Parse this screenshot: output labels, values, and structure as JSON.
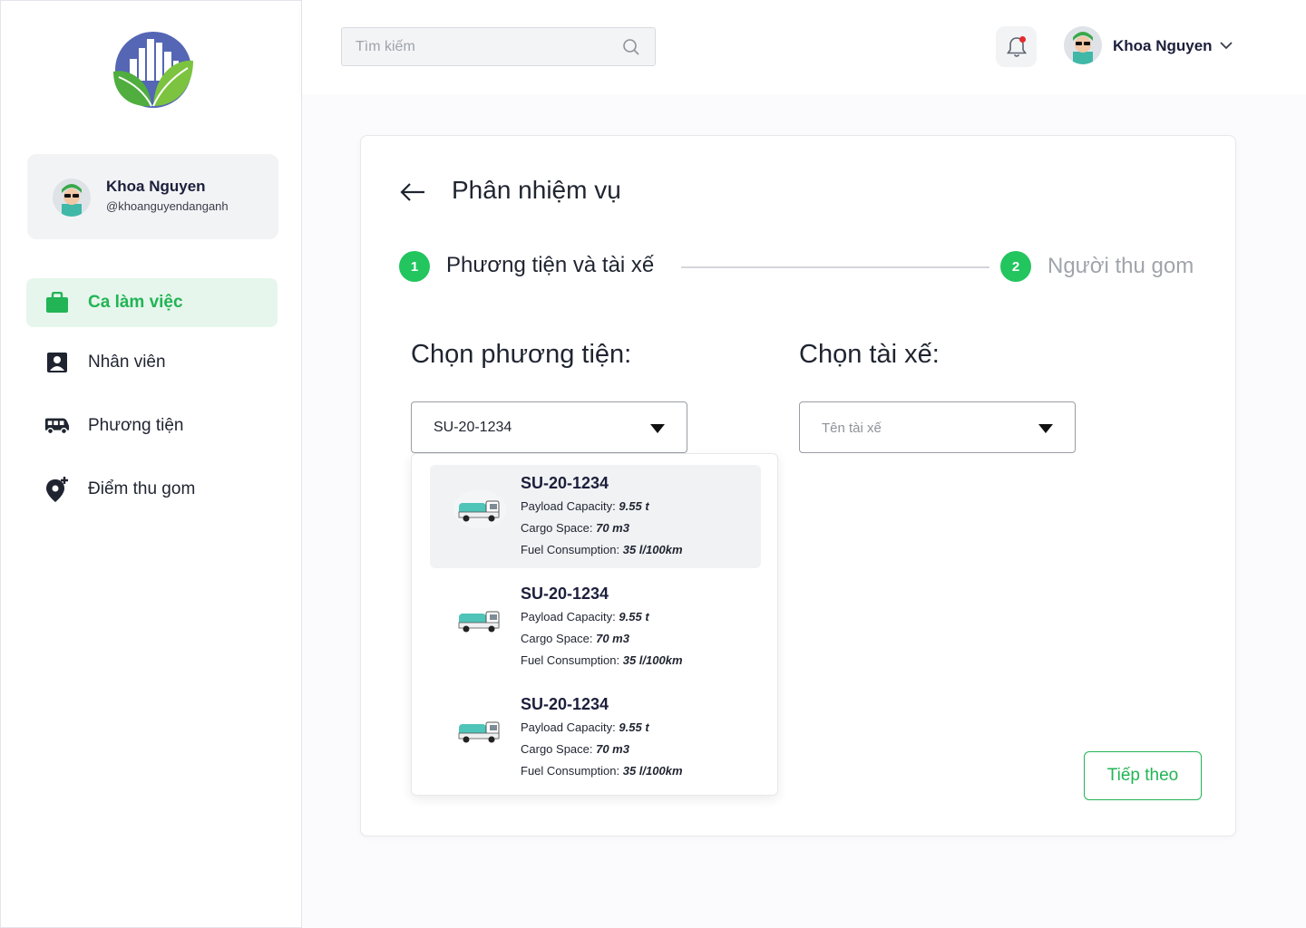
{
  "sidebar": {
    "profile": {
      "name": "Khoa Nguyen",
      "handle": "@khoanguyendanganh"
    },
    "items": [
      {
        "label": "Ca làm việc",
        "icon": "briefcase-icon",
        "active": true
      },
      {
        "label": "Nhân viên",
        "icon": "contact-card-icon",
        "active": false
      },
      {
        "label": "Phương tiện",
        "icon": "van-icon",
        "active": false
      },
      {
        "label": "Điểm thu gom",
        "icon": "location-add-icon",
        "active": false
      }
    ]
  },
  "header": {
    "search_placeholder": "Tìm kiếm",
    "user_name": "Khoa Nguyen",
    "has_notification": true
  },
  "main": {
    "title": "Phân nhiệm vụ",
    "steps": [
      {
        "number": "1",
        "label": "Phương tiện và tài xế"
      },
      {
        "number": "2",
        "label": "Người thu gom"
      }
    ],
    "vehicle": {
      "title": "Chọn phương tiện:",
      "selected": "SU-20-1234",
      "options": [
        {
          "plate": "SU-20-1234",
          "payload_label": "Payload Capacity: ",
          "payload": "9.55 t",
          "cargo_label": "Cargo Space: ",
          "cargo": "70 m3",
          "fuel_label": "Fuel Consumption: ",
          "fuel": "35 l/100km"
        },
        {
          "plate": "SU-20-1234",
          "payload_label": "Payload Capacity: ",
          "payload": "9.55 t",
          "cargo_label": "Cargo Space: ",
          "cargo": "70 m3",
          "fuel_label": "Fuel Consumption: ",
          "fuel": "35 l/100km"
        },
        {
          "plate": "SU-20-1234",
          "payload_label": "Payload Capacity: ",
          "payload": "9.55 t",
          "cargo_label": "Cargo Space: ",
          "cargo": "70 m3",
          "fuel_label": "Fuel Consumption: ",
          "fuel": "35 l/100km"
        }
      ]
    },
    "driver": {
      "title": "Chọn tài xế:",
      "placeholder": "Tên tài xế"
    },
    "next_label": "Tiếp theo"
  },
  "colors": {
    "accent": "#22c55e",
    "accent_text": "#22b455",
    "active_bg": "#e6f6ec",
    "notification": "#e52b2b"
  }
}
